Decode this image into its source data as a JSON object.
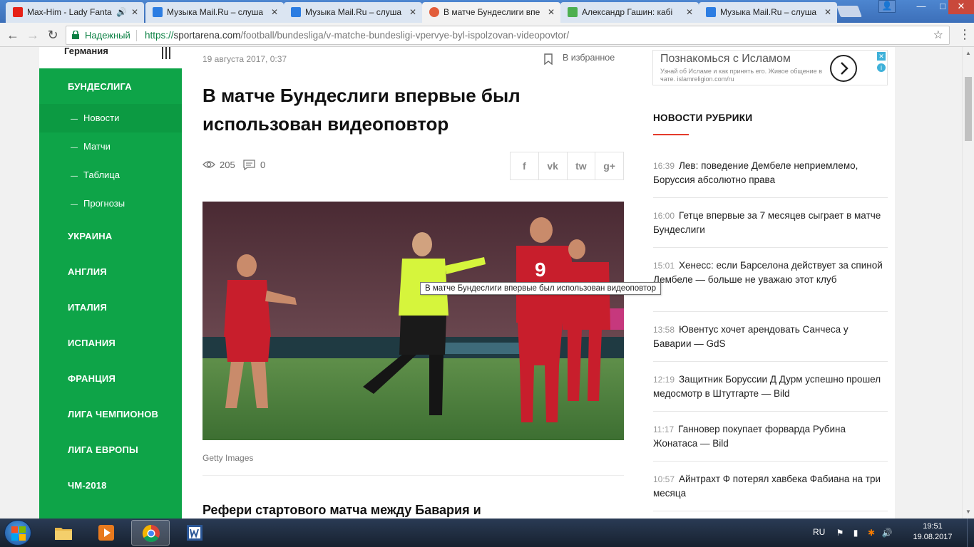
{
  "browser": {
    "tabs": [
      {
        "label": "Max-Him - Lady Fanta",
        "icon": "youtube-icon",
        "color": "#e62117"
      },
      {
        "label": "Музыка Mail.Ru – слуша",
        "icon": "mail-ru-music-icon",
        "color": "#2c7de2"
      },
      {
        "label": "Музыка Mail.Ru – слуша",
        "icon": "mail-ru-music-icon",
        "color": "#2c7de2"
      },
      {
        "label": "В матче Бундеслиги впе",
        "icon": "sportarena-icon",
        "color": "#e25d3a"
      },
      {
        "label": "Александр Гашин: кабі",
        "icon": "green-page-icon",
        "color": "#4caf50"
      },
      {
        "label": "Музыка Mail.Ru – слуша",
        "icon": "mail-ru-music-icon",
        "color": "#2c7de2"
      }
    ],
    "security_label": "Надежный",
    "url_scheme": "https://",
    "url_host": "sportarena.com",
    "url_path": "/football/bundesliga/v-matche-bundesligi-vpervye-byl-ispolzovan-videopovtor/"
  },
  "sidebar": {
    "country": "Германия",
    "section": "БУНДЕСЛИГА",
    "subitems": [
      "Новости",
      "Матчи",
      "Таблица",
      "Прогнозы"
    ],
    "items": [
      "УКРАИНА",
      "АНГЛИЯ",
      "ИТАЛИЯ",
      "ИСПАНИЯ",
      "ФРАНЦИЯ",
      "ЛИГА ЧЕМПИОНОВ",
      "ЛИГА ЕВРОПЫ",
      "ЧМ-2018"
    ],
    "accent": "#0ea448"
  },
  "article": {
    "date": "19 августа 2017, 0:37",
    "favorite_label": "В избранное",
    "title": "В матче Бундеслиги впервые был использован видеоповтор",
    "views": "205",
    "comments": "0",
    "share": [
      "f",
      "vk",
      "tw",
      "g+"
    ],
    "tooltip": "В матче Бундеслиги впервые был использован видеоповтор",
    "caption": "Getty Images",
    "lead": "Рефери стартового матча между Бавария и"
  },
  "ad": {
    "title": "Познакомься с Исламом",
    "subtitle": "Узнай об Исламе и как принять его. Живое общение в чате.",
    "domain": "islamreligion.com/ru",
    "close": "✕",
    "info": "i"
  },
  "rubric": {
    "title": "НОВОСТИ РУБРИКИ",
    "accent": "#e43b2c",
    "items": [
      {
        "time": "16:39",
        "text": "Лев: поведение Дембеле неприемлемо, Боруссия абсолютно права"
      },
      {
        "time": "16:00",
        "text": "Гетце впервые за 7 месяцев сыграет в матче Бундеслиги"
      },
      {
        "time": "15:01",
        "text": "Хенесс: если Барселона действует за спиной Дембеле — больше не уважаю этот клуб"
      },
      {
        "time": "13:58",
        "text": "Ювентус хочет арендовать Санчеса у Баварии — GdS"
      },
      {
        "time": "12:19",
        "text": "Защитник Боруссии Д Дурм успешно прошел медосмотр в Штутгарте — Bild"
      },
      {
        "time": "11:17",
        "text": "Ганновер покупает форварда Рубина Жонатаса — Bild"
      },
      {
        "time": "10:57",
        "text": "Айнтрахт Ф потерял хавбека Фабиана на три месяца"
      }
    ]
  },
  "taskbar": {
    "lang": "RU",
    "time": "19:51",
    "date": "19.08.2017"
  }
}
